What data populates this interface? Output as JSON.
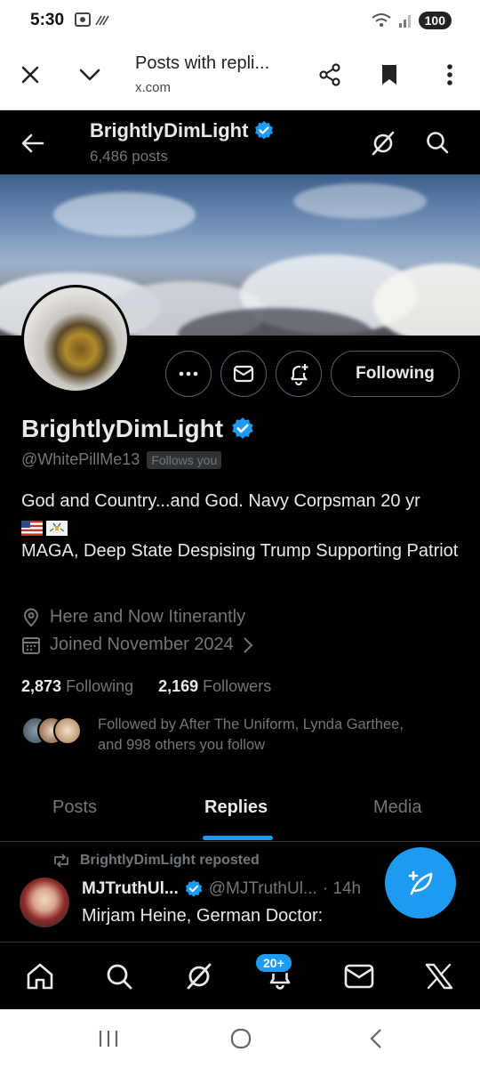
{
  "status_bar": {
    "time": "5:30",
    "battery": "100",
    "icons": [
      "screenshot-icon",
      "nfc-icon",
      "wifi-icon",
      "signal-icon",
      "battery-icon"
    ]
  },
  "browser": {
    "title": "Posts with repli...",
    "url": "x.com",
    "icons": [
      "close-icon",
      "chevron-down-icon",
      "share-icon",
      "bookmark-icon",
      "more-vertical-icon"
    ]
  },
  "header": {
    "name": "BrightlyDimLight",
    "posts_count": "6,486 posts"
  },
  "profile": {
    "name": "BrightlyDimLight",
    "handle": "@WhitePillMe13",
    "follows_you": "Follows you",
    "follow_button": "Following",
    "bio_line1": "God and Country...and God. Navy Corpsman 20 yr",
    "bio_line2": "MAGA, Deep State Despising Trump Supporting Patriot",
    "location": "Here and Now Itinerantly",
    "joined": "Joined November 2024",
    "following_count": "2,873",
    "following_label": "Following",
    "followers_count": "2,169",
    "followers_label": "Followers",
    "followed_by_line1": "Followed by After The Uniform, Lynda Garthee,",
    "followed_by_line2": "and 998 others you follow"
  },
  "tabs": [
    {
      "label": "Posts",
      "active": false
    },
    {
      "label": "Replies",
      "active": true
    },
    {
      "label": "Media",
      "active": false
    }
  ],
  "tweet": {
    "repost_label": "BrightlyDimLight reposted",
    "author_name": "MJTruthUl...",
    "author_handle": "@MJTruthUl...",
    "time": "· 14h",
    "text": "Mirjam Heine, German Doctor:"
  },
  "bottom_nav": {
    "badge": "20+",
    "items": [
      "home-icon",
      "search-icon",
      "grok-icon",
      "notifications-icon",
      "messages-icon",
      "x-logo-icon"
    ]
  },
  "colors": {
    "accent": "#1d9bf0",
    "background": "#000000",
    "secondary_text": "#71767b"
  }
}
